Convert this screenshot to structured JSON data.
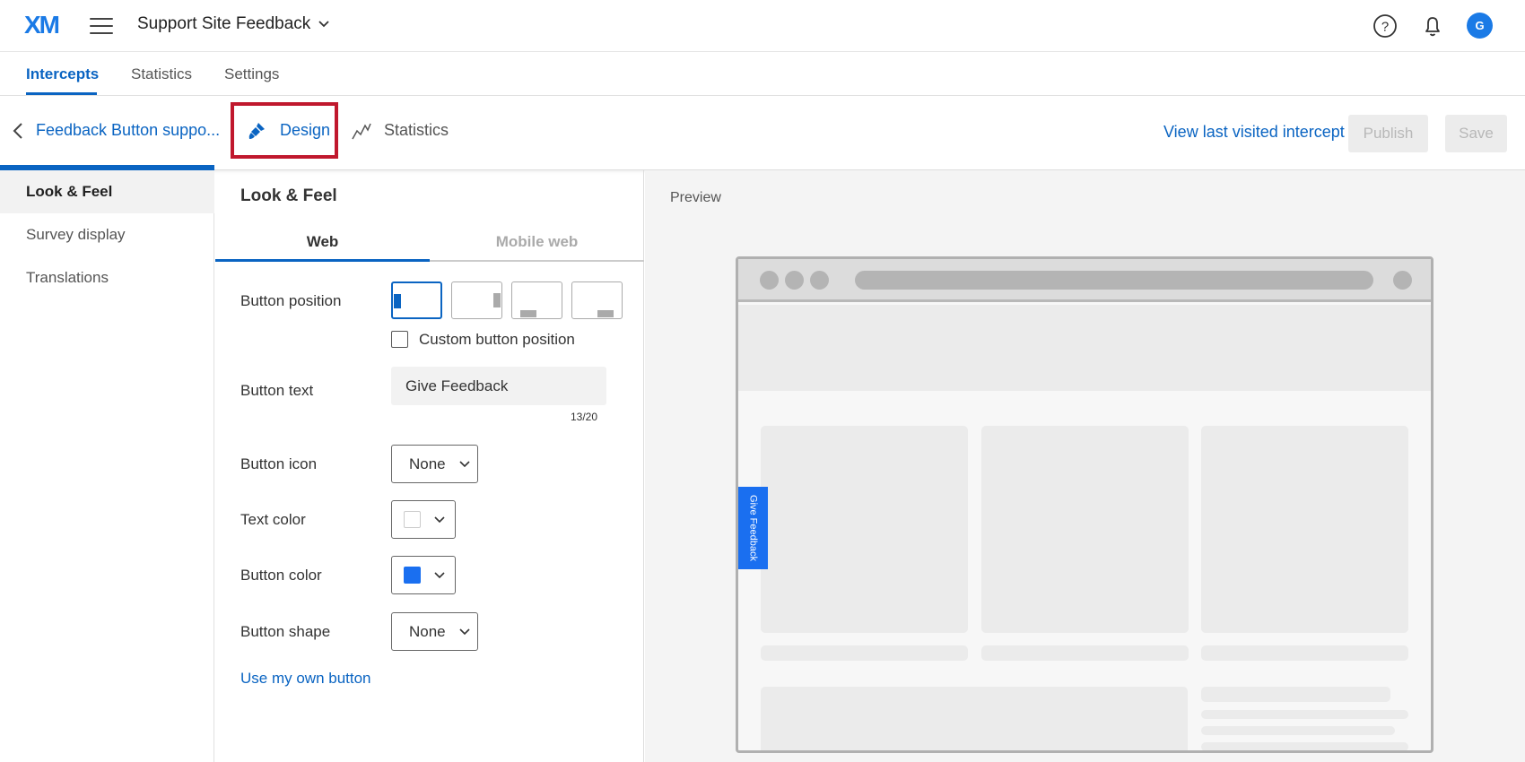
{
  "app": {
    "logo": "XM",
    "project_title": "Support Site Feedback",
    "avatar_initial": "G"
  },
  "tabs": [
    {
      "label": "Intercepts",
      "active": true
    },
    {
      "label": "Statistics",
      "active": false
    },
    {
      "label": "Settings",
      "active": false
    }
  ],
  "sub_header": {
    "back_label": "Feedback Button suppo...",
    "design_label": "Design",
    "statistics_label": "Statistics",
    "view_last_label": "View last visited intercept",
    "publish_label": "Publish",
    "save_label": "Save"
  },
  "sidebar": {
    "items": [
      {
        "label": "Look & Feel",
        "active": true
      },
      {
        "label": "Survey display",
        "active": false
      },
      {
        "label": "Translations",
        "active": false
      }
    ]
  },
  "panel": {
    "title": "Look & Feel",
    "tab_web": "Web",
    "tab_mobile": "Mobile web",
    "button_position_label": "Button position",
    "custom_position_label": "Custom button position",
    "button_text_label": "Button text",
    "button_text_value": "Give Feedback",
    "char_count": "13/20",
    "button_icon_label": "Button icon",
    "button_icon_value": "None",
    "text_color_label": "Text color",
    "text_color_value": "#ffffff",
    "button_color_label": "Button color",
    "button_color_value": "#1a6ff0",
    "button_shape_label": "Button shape",
    "button_shape_value": "None",
    "own_button_label": "Use my own button"
  },
  "preview": {
    "label": "Preview",
    "feedback_tab_text": "Give Feedback"
  },
  "colors": {
    "accent": "#0a64c2",
    "highlight_border": "#c0182d"
  }
}
